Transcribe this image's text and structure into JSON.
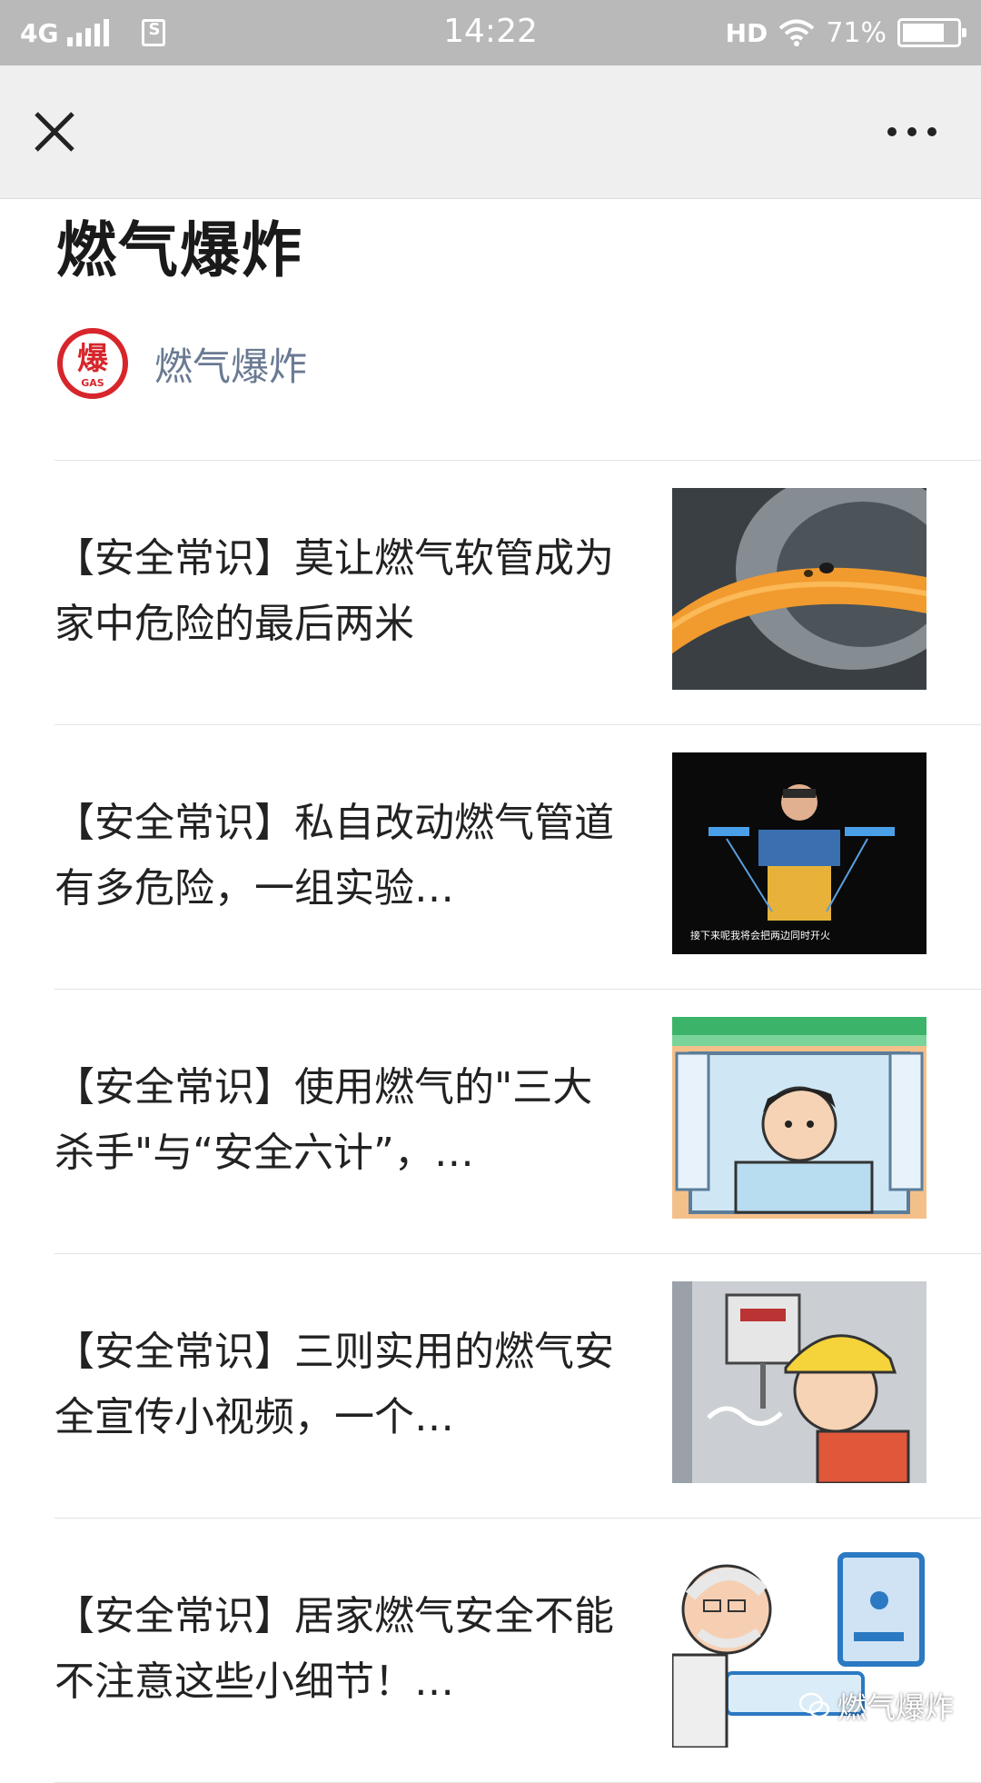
{
  "status_bar": {
    "network": "4G",
    "time": "14:22",
    "hd": "HD",
    "battery": "71%",
    "icons": [
      "signal-icon",
      "sim-icon",
      "wifi-icon",
      "battery-charging-icon"
    ]
  },
  "nav": {
    "close_icon": "close-icon",
    "more_icon": "more-icon"
  },
  "header": {
    "title": "燃气爆炸",
    "account_name": "燃气爆炸",
    "avatar_text": "爆",
    "avatar_subtext": "GAS",
    "brand_color": "#d7262b"
  },
  "articles": [
    {
      "title": "【安全常识】莫让燃气软管成为家中危险的最后两米"
    },
    {
      "title": "【安全常识】私自改动燃气管道有多危险，一组实验…",
      "thumb_caption": "接下来呢我将会把两边同时开火"
    },
    {
      "title": "【安全常识】使用燃气的\"三大杀手\"与“安全六计”，…"
    },
    {
      "title": "【安全常识】三则实用的燃气安全宣传小视频，一个…"
    },
    {
      "title": "【安全常识】居家燃气安全不能不注意这些小细节！…"
    }
  ],
  "watermark": "燃气爆炸"
}
